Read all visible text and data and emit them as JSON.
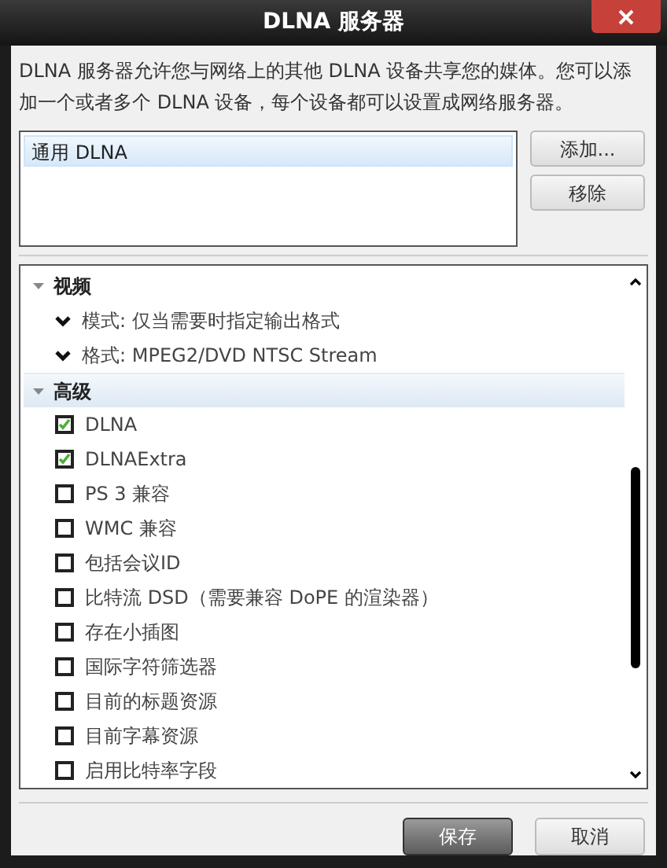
{
  "window": {
    "title": "DLNA 服务器"
  },
  "description": "DLNA 服务器允许您与网络上的其他 DLNA 设备共享您的媒体。您可以添加一个或者多个 DLNA 设备，每个设备都可以设置成网络服务器。",
  "devices": [
    {
      "label": "通用 DLNA",
      "selected": true
    }
  ],
  "device_buttons": [
    "添加...",
    "移除"
  ],
  "sections": [
    {
      "title": "视频",
      "expanded": true,
      "selected": false,
      "items": [
        {
          "kind": "dropdown",
          "label": "模式: 仅当需要时指定输出格式"
        },
        {
          "kind": "dropdown",
          "label": "格式: MPEG2/DVD NTSC Stream"
        }
      ]
    },
    {
      "title": "高级",
      "expanded": true,
      "selected": true,
      "items": [
        {
          "kind": "checkbox",
          "label": "DLNA",
          "checked": true
        },
        {
          "kind": "checkbox",
          "label": "DLNAExtra",
          "checked": true
        },
        {
          "kind": "checkbox",
          "label": "PS 3 兼容",
          "checked": false
        },
        {
          "kind": "checkbox",
          "label": "WMC 兼容",
          "checked": false
        },
        {
          "kind": "checkbox",
          "label": "包括会议ID",
          "checked": false
        },
        {
          "kind": "checkbox",
          "label": "比特流 DSD（需要兼容 DoPE 的渲染器）",
          "checked": false
        },
        {
          "kind": "checkbox",
          "label": "存在小插图",
          "checked": false
        },
        {
          "kind": "checkbox",
          "label": "国际字符筛选器",
          "checked": false
        },
        {
          "kind": "checkbox",
          "label": "目前的标题资源",
          "checked": false
        },
        {
          "kind": "checkbox",
          "label": "目前字幕资源",
          "checked": false
        },
        {
          "kind": "checkbox",
          "label": "启用比特率字段",
          "checked": false
        }
      ]
    }
  ],
  "footer_buttons": [
    {
      "label": "保存",
      "default": true
    },
    {
      "label": "取消",
      "default": false
    }
  ]
}
